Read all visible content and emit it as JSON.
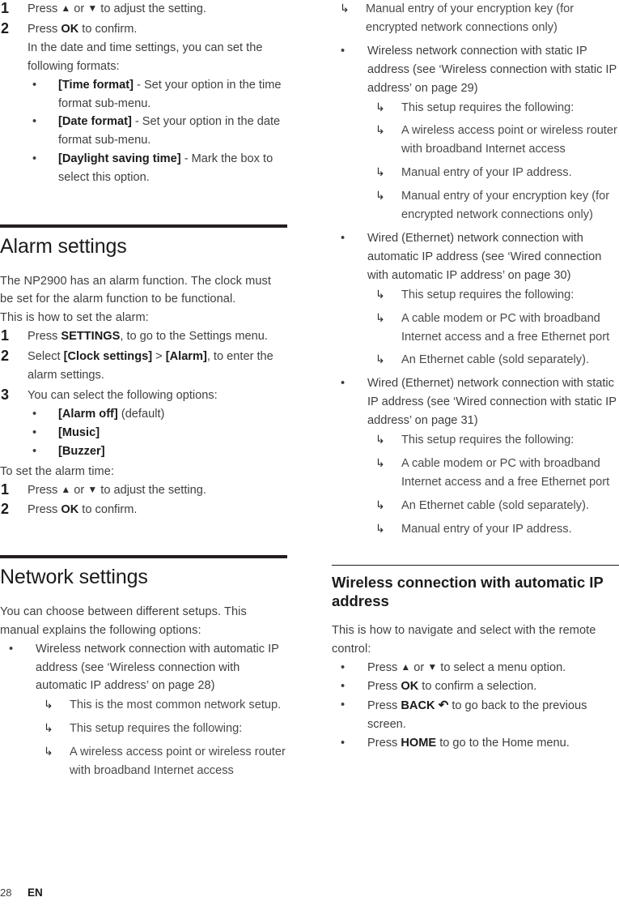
{
  "document": {
    "footer": {
      "page_number": "28",
      "language": "EN"
    }
  },
  "left_column": {
    "continued_steps": [
      {
        "num": "1",
        "text_before": "Press ",
        "key": "▲",
        "text_mid": " or ",
        "key2": "▼",
        "text_after": " to adjust the setting."
      },
      {
        "num": "2",
        "text_before": "Press ",
        "key": "OK",
        "text_after": " to confirm."
      }
    ],
    "step2_body": "In the date and time settings, you can set the following formats:",
    "format_bullets": [
      {
        "bold": "[Time format]",
        "rest": " - Set your option in the time format sub-menu."
      },
      {
        "bold": "[Date format]",
        "rest": " - Set your option in the date format sub-menu."
      },
      {
        "bold": "[Daylight saving time]",
        "rest": " - Mark the box to select this option."
      }
    ],
    "alarm_section": {
      "title": "Alarm settings",
      "intro": "The NP2900 has an alarm function. The clock must be set for the alarm function to be functional.",
      "lead_in": "This is how to set the alarm:",
      "steps": [
        {
          "num": "1",
          "pre": "Press ",
          "bold": "SETTINGS",
          "post": ", to go to the Settings menu."
        },
        {
          "num": "2",
          "pre": "Select ",
          "bold": "[Clock settings]",
          "mid": " > ",
          "bold2": "[Alarm]",
          "post": ", to enter the alarm settings."
        },
        {
          "num": "3",
          "pre": "You can select the following options:",
          "bold": "",
          "post": ""
        }
      ],
      "options": [
        {
          "bold": "[Alarm off]",
          "rest": " (default)"
        },
        {
          "bold": "[Music]",
          "rest": ""
        },
        {
          "bold": "[Buzzer]",
          "rest": ""
        }
      ],
      "time_lead_in": "To set the alarm time:",
      "time_steps": [
        {
          "num": "1",
          "pre": "Press ",
          "key": "▲",
          "mid": " or ",
          "key2": "▼",
          "post": " to adjust the setting."
        },
        {
          "num": "2",
          "pre": "Press ",
          "bold": "OK",
          "post": " to confirm."
        }
      ]
    },
    "network_section": {
      "title": "Network settings",
      "intro": "You can choose between different setups. This manual explains the following options:",
      "bullet": "Wireless network connection with automatic IP address (see ‘Wireless connection with automatic IP address’ on page 28)",
      "sub_items": [
        "This is the most common network setup.",
        "This setup requires the following:",
        "A wireless access point or wireless router with broadband Internet access"
      ]
    }
  },
  "right_column": {
    "continued_sub_items": [
      "Manual entry of your encryption key (for encrypted network connections only)"
    ],
    "bullets": [
      {
        "text": "Wireless network connection with static IP address (see ‘Wireless connection with static IP address’ on page 29)",
        "sub_items": [
          "This setup requires the following:",
          "A wireless access point or wireless router with broadband Internet access",
          "Manual entry of your IP address.",
          "Manual entry of your encryption key (for encrypted network connections only)"
        ]
      },
      {
        "text": "Wired (Ethernet) network connection with automatic IP address (see ‘Wired connection with automatic IP address’ on page 30)",
        "sub_items": [
          "This setup requires the following:",
          "A cable modem or PC with broadband Internet access and a free Ethernet port",
          "An Ethernet cable (sold separately)."
        ]
      },
      {
        "text": "Wired (Ethernet) network connection with static IP address (see ‘Wired connection with static IP address’ on page 31)",
        "sub_items": [
          "This setup requires the following:",
          "A cable modem or PC with broadband Internet access and a free Ethernet port",
          "An Ethernet cable (sold separately).",
          "Manual entry of your IP address."
        ]
      }
    ],
    "wireless_auto_section": {
      "title": "Wireless connection with automatic IP address",
      "intro": "This is how to navigate and select with the remote control:",
      "remote_bullets": [
        {
          "pre": "Press ",
          "key": "▲",
          "mid": " or ",
          "key2": "▼",
          "post": " to select a menu option."
        },
        {
          "pre": "Press ",
          "bold": "OK",
          "post": " to confirm a selection."
        },
        {
          "pre": "Press ",
          "bold": "BACK",
          "icon": "back-arrow-icon",
          "post": " to go back to the previous screen."
        },
        {
          "pre": "Press ",
          "bold": "HOME",
          "post": " to go to the Home menu."
        }
      ]
    }
  },
  "icons": {
    "arrow_sub": "↳",
    "up": "▲",
    "down": "▼",
    "bullet": "•",
    "back": "↩"
  }
}
